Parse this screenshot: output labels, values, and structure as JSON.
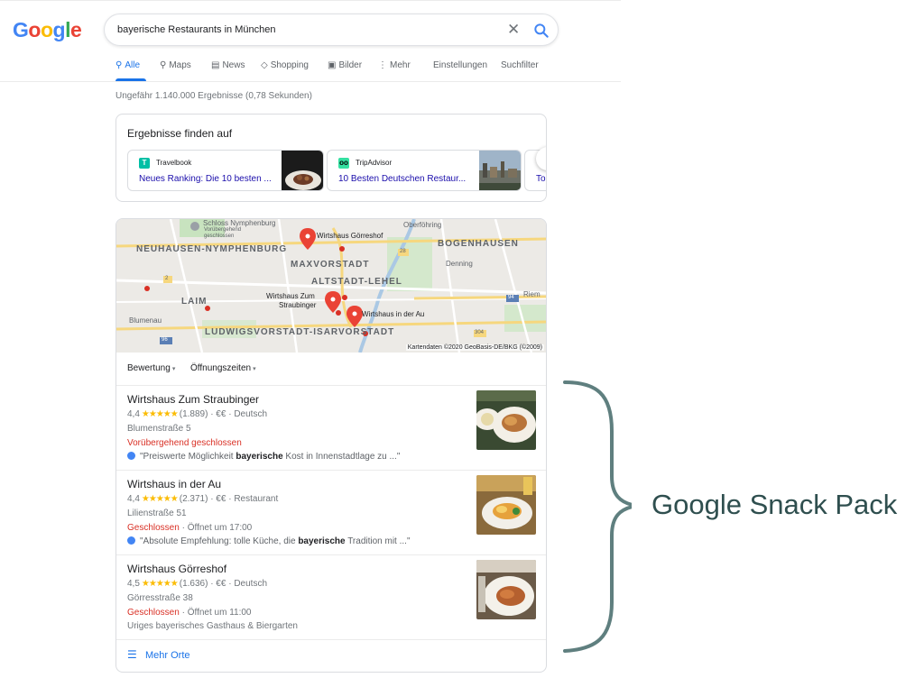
{
  "logo": {
    "text_1": "G",
    "text_2": "o",
    "text_3": "o",
    "text_4": "g",
    "text_5": "l",
    "text_6": "e"
  },
  "search": {
    "query": "bayerische Restaurants in München"
  },
  "tabs": [
    {
      "label": "Alle",
      "icon": "search-icon"
    },
    {
      "label": "Maps",
      "icon": "map-pin-icon"
    },
    {
      "label": "News",
      "icon": "news-icon"
    },
    {
      "label": "Shopping",
      "icon": "tag-icon"
    },
    {
      "label": "Bilder",
      "icon": "image-icon"
    },
    {
      "label": "Mehr",
      "icon": "more-vert-icon"
    },
    {
      "label": "Einstellungen"
    },
    {
      "label": "Suchfilter"
    }
  ],
  "stats": "Ungefähr 1.140.000 Ergebnisse (0,78 Sekunden)",
  "find_results": {
    "title": "Ergebnisse finden auf",
    "sources": [
      {
        "name": "Travelbook",
        "title": "Neues Ranking: Die 10 besten ...",
        "icon_letter": "T",
        "icon_color": "#00bfa5"
      },
      {
        "name": "TripAdvisor",
        "title": "10 Besten Deutschen Restaur...",
        "icon_letter": "oo",
        "icon_color": "#34e0a1"
      },
      {
        "name": "",
        "title": "Top",
        "icon_letter": "",
        "icon_color": "#ffffff"
      }
    ]
  },
  "map": {
    "labels": {
      "schloss": "Schloss Nymphenburg",
      "schloss_sub1": "Vorübergehend",
      "schloss_sub2": "geschlossen",
      "oberfoehring": "Oberföhring",
      "neuhausen": "NEUHAUSEN-NYMPHENBURG",
      "bogenhausen": "BOGENHAUSEN",
      "maxvorstadt": "MAXVORSTADT",
      "denning": "Denning",
      "altstadt": "ALTSTADT-LEHEL",
      "laim": "LAIM",
      "riem": "Riem",
      "blumenau": "Blumenau",
      "ludwigsvorstadt": "LUDWIGSVORSTADT-ISARVORSTADT",
      "pin_goerreshof": "Wirtshaus Görreshof",
      "pin_straubinger_1": "Wirtshaus Zum",
      "pin_straubinger_2": "Straubinger",
      "pin_au": "Wirtshaus in der Au",
      "road_2": "2",
      "road_96": "96",
      "road_94": "94",
      "road_304": "304",
      "road_28": "28"
    },
    "credit": "Kartendaten ©2020 GeoBasis-DE/BKG (©2009)"
  },
  "filters": [
    {
      "label": "Bewertung"
    },
    {
      "label": "Öffnungszeiten"
    }
  ],
  "places": [
    {
      "name": "Wirtshaus Zum Straubinger",
      "score": "4,4",
      "stars": "★★★★★",
      "reviews": "(1.889) · €€ · Deutsch",
      "address": "Blumenstraße 5",
      "status_closed": "Vorübergehend geschlossen",
      "status_rest": "",
      "review_pre": "\"Preiswerte Möglichkeit ",
      "review_bold": "bayerische",
      "review_post": " Kost in Innenstadtlage zu ...\""
    },
    {
      "name": "Wirtshaus in der Au",
      "score": "4,4",
      "stars": "★★★★★",
      "reviews": "(2.371) · €€ · Restaurant",
      "address": "Lilienstraße 51",
      "status_closed": "Geschlossen",
      "status_rest": " · Öffnet um 17:00",
      "review_pre": "\"Absolute Empfehlung: tolle Küche, die ",
      "review_bold": "bayerische",
      "review_post": " Tradition mit ...\""
    },
    {
      "name": "Wirtshaus Görreshof",
      "score": "4,5",
      "stars": "★★★★★",
      "reviews": "(1.636) · €€ · Deutsch",
      "address": "Görresstraße 38",
      "status_closed": "Geschlossen",
      "status_rest": " · Öffnet um 11:00",
      "description": "Uriges bayerisches Gasthaus & Biergarten"
    }
  ],
  "more_places": "Mehr Orte",
  "annotation": "Google Snack Pack",
  "colors": {
    "link": "#1a0dab",
    "accent": "#1a73e8",
    "closed": "#d93025",
    "star": "#fbbc05",
    "annotation": "#2f4f4f"
  }
}
